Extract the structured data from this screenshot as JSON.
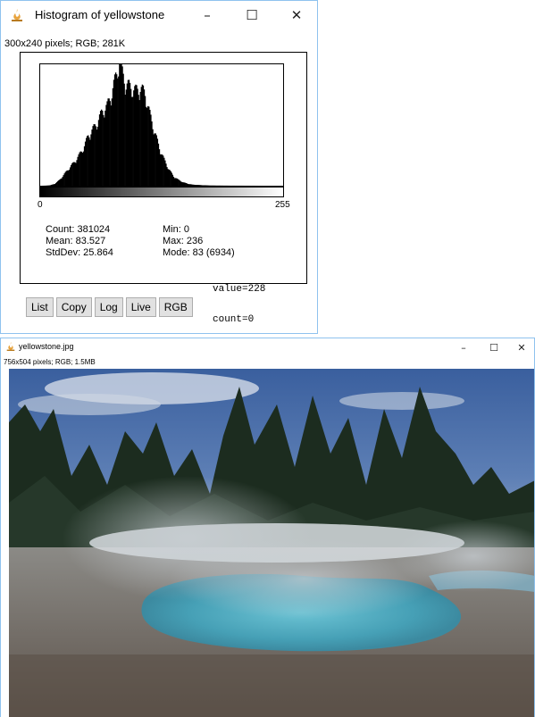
{
  "histogram_window": {
    "title": "Histogram of yellowstone",
    "info": "300x240 pixels; RGB; 281K",
    "axis": {
      "min_label": "0",
      "max_label": "255"
    },
    "stats": {
      "count": "Count: 381024",
      "mean": "Mean: 83.527",
      "stddev": "StdDev: 25.864",
      "min": "Min: 0",
      "max": "Max: 236",
      "mode": "Mode: 83 (6934)"
    },
    "buttons": [
      "List",
      "Copy",
      "Log",
      "Live",
      "RGB"
    ],
    "value_readout": "value=228",
    "count_readout": "count=0"
  },
  "image_window": {
    "title": "yellowstone.jpg",
    "info": "756x504 pixels; RGB; 1.5MB"
  },
  "window_controls": {
    "minimize": "–",
    "maximize": "☐",
    "close": "✕"
  },
  "colors": {
    "window_border": "#8fc2ee",
    "icon_flame": "#e8a33c",
    "button_face": "#e1e1e1",
    "sky": "#3f67a6",
    "pool": "#49a2b8"
  },
  "icons": {
    "app": "imagej-flame-icon"
  },
  "chart_data": {
    "type": "bar",
    "x_range": [
      0,
      255
    ],
    "count_range": [
      0,
      6934
    ],
    "mode_bin": 83,
    "mode_count": 6934,
    "profile_bins": [
      0,
      5,
      10,
      15,
      20,
      25,
      30,
      35,
      40,
      45,
      50,
      55,
      60,
      65,
      70,
      75,
      80,
      83,
      85,
      90,
      95,
      100,
      105,
      110,
      115,
      120,
      125,
      130,
      135,
      140,
      145,
      150,
      155,
      160,
      170,
      180,
      200,
      236
    ],
    "profile_counts": [
      0,
      5,
      25,
      110,
      330,
      650,
      980,
      1280,
      1650,
      2080,
      2750,
      3120,
      3530,
      4130,
      4400,
      5150,
      6200,
      6934,
      6400,
      5600,
      5440,
      5250,
      5400,
      5100,
      3940,
      2980,
      2100,
      1450,
      910,
      520,
      330,
      190,
      110,
      60,
      30,
      12,
      4,
      0
    ]
  }
}
